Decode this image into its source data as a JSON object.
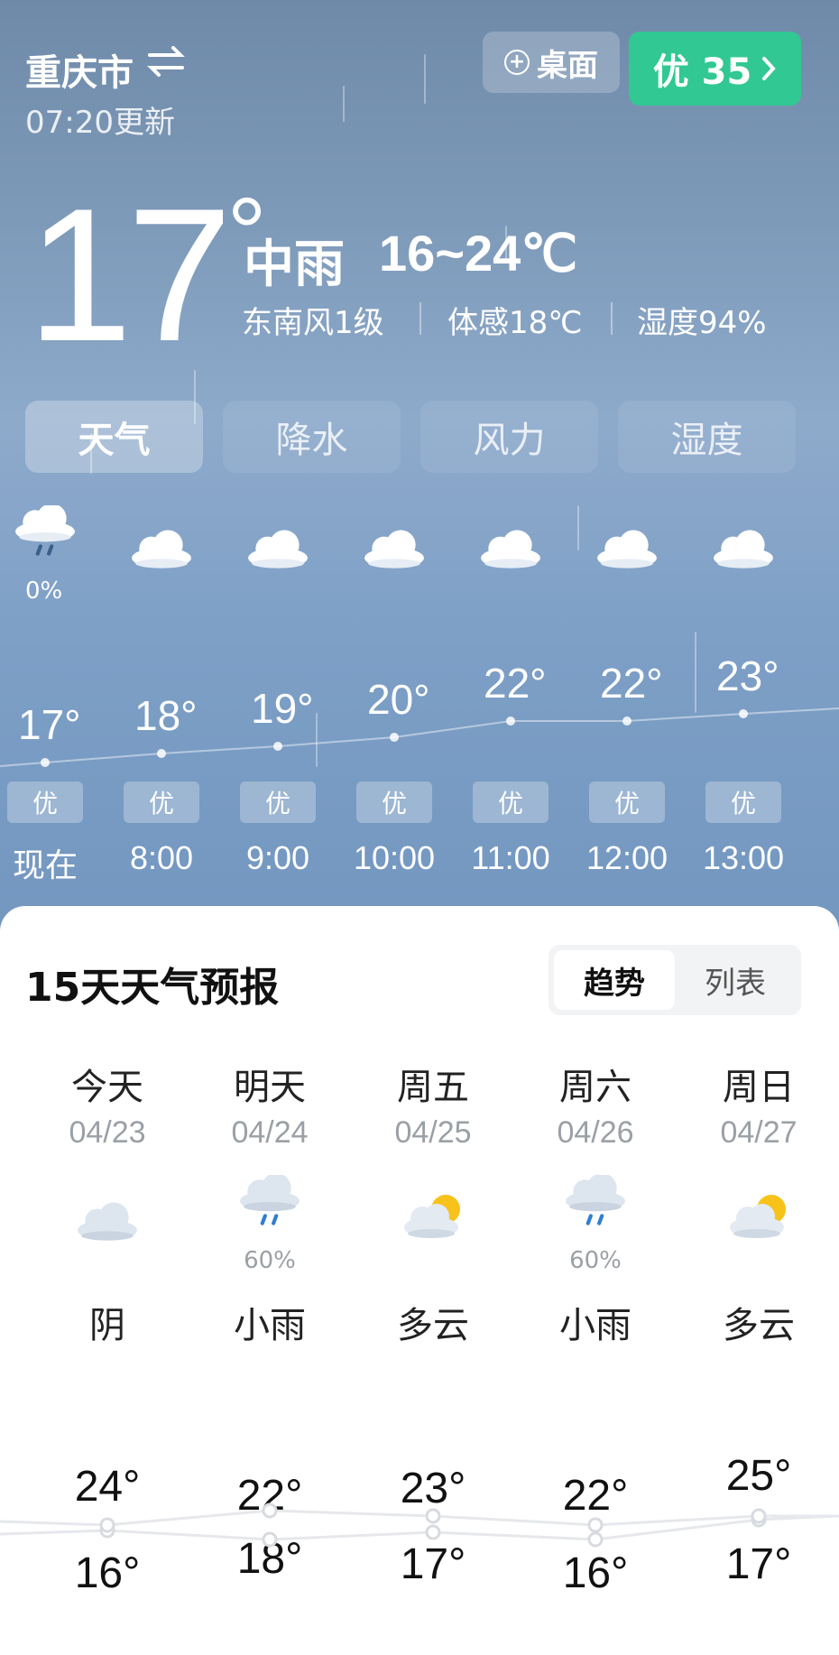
{
  "header": {
    "city": "重庆市",
    "swap_icon": "swap-icon",
    "updated": "07:20更新",
    "desktop_button": "桌面",
    "aqi_button": "优 35"
  },
  "current": {
    "temp": "17",
    "degree": "°",
    "condition": "中雨",
    "range": "16~24℃",
    "wind": "东南风1级",
    "feels": "体感18℃",
    "humidity": "湿度94%"
  },
  "tabs": [
    "天气",
    "降水",
    "风力",
    "湿度"
  ],
  "hourly": [
    {
      "time": "现在",
      "temp": "17°",
      "aqi": "优",
      "icon": "rain-cloud-icon",
      "pct": "0%"
    },
    {
      "time": "8:00",
      "temp": "18°",
      "aqi": "优",
      "icon": "cloud-icon",
      "pct": ""
    },
    {
      "time": "9:00",
      "temp": "19°",
      "aqi": "优",
      "icon": "cloud-icon",
      "pct": ""
    },
    {
      "time": "10:00",
      "temp": "20°",
      "aqi": "优",
      "icon": "cloud-icon",
      "pct": ""
    },
    {
      "time": "11:00",
      "temp": "22°",
      "aqi": "优",
      "icon": "cloud-icon",
      "pct": ""
    },
    {
      "time": "12:00",
      "temp": "22°",
      "aqi": "优",
      "icon": "cloud-icon",
      "pct": ""
    },
    {
      "time": "13:00",
      "temp": "23°",
      "aqi": "优",
      "icon": "cloud-icon",
      "pct": ""
    }
  ],
  "forecast": {
    "title": "15天天气预报",
    "toggle": {
      "trend": "趋势",
      "list": "列表"
    },
    "days": [
      {
        "name": "今天",
        "date": "04/23",
        "icon": "cloud-icon",
        "pct": "",
        "cond": "阴",
        "hi": "24°",
        "lo": "16°"
      },
      {
        "name": "明天",
        "date": "04/24",
        "icon": "rain-cloud-icon",
        "pct": "60%",
        "cond": "小雨",
        "hi": "22°",
        "lo": "18°"
      },
      {
        "name": "周五",
        "date": "04/25",
        "icon": "sun-cloud-icon",
        "pct": "",
        "cond": "多云",
        "hi": "23°",
        "lo": "17°"
      },
      {
        "name": "周六",
        "date": "04/26",
        "icon": "rain-cloud-icon",
        "pct": "60%",
        "cond": "小雨",
        "hi": "22°",
        "lo": "16°"
      },
      {
        "name": "周日",
        "date": "04/27",
        "icon": "sun-cloud-icon",
        "pct": "",
        "cond": "多云",
        "hi": "25°",
        "lo": "17°"
      }
    ]
  },
  "colors": {
    "aqi_green": "#31c893",
    "sky_top": "#6f8aa9",
    "sky_bottom": "#7397c0",
    "sun": "#f7c21a"
  }
}
